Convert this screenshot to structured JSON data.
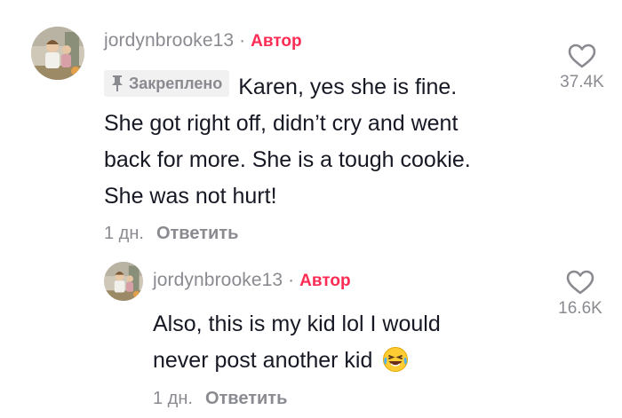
{
  "comments": [
    {
      "username": "jordynbrooke13",
      "separator": "·",
      "author_badge": "Автор",
      "pinned_label": "Закреплено",
      "text_first": "Karen, yes she is fine.",
      "text_lines": [
        "She got right off, didn’t cry and went",
        "back for more. She is a tough cookie.",
        "She was not hurt!"
      ],
      "time": "1 дн.",
      "reply_label": "Ответить",
      "likes": "37.4K",
      "icon": "heart-outline-icon"
    },
    {
      "username": "jordynbrooke13",
      "separator": "·",
      "author_badge": "Автор",
      "text_lines": [
        "Also, this is my kid lol I would",
        "never post another kid"
      ],
      "emoji": "😂",
      "time": "1 дн.",
      "reply_label": "Ответить",
      "likes": "16.6K",
      "icon": "heart-outline-icon"
    }
  ],
  "colors": {
    "author_accent": "#fe2c55",
    "secondary_text": "#8a8b91",
    "primary_text": "#161823",
    "pinned_bg": "#f1f1f2"
  }
}
